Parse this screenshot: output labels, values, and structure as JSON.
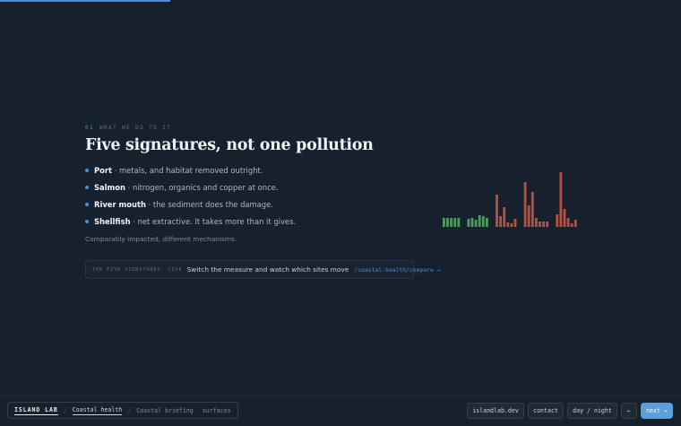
{
  "progress": {
    "fraction": 0.25
  },
  "section": {
    "number": "01",
    "eyebrow": "WHAT WE DO TO IT",
    "title": "Five signatures, not one pollution",
    "bullets": [
      {
        "term": "Port",
        "text": " · metals, and habitat removed outright."
      },
      {
        "term": "Salmon",
        "text": " · nitrogen, organics and copper at once."
      },
      {
        "term": "River mouth",
        "text": " · the sediment does the damage."
      },
      {
        "term": "Shellfish",
        "text": " · net extractive. It takes more than it gives."
      }
    ],
    "caption": "Comparably impacted, different mechanisms."
  },
  "callout": {
    "tag": "THE FIVE SIGNATURES, LIVE",
    "message": "Switch the measure and watch which sites move",
    "link": "/coastal-health/compare →"
  },
  "chart_data": {
    "type": "bar",
    "title": "",
    "xlabel": "",
    "ylabel": "",
    "ylim": [
      0,
      62
    ],
    "groups": [
      {
        "color": "#4f9a5f",
        "values": [
          10,
          10,
          10,
          10,
          10
        ]
      },
      {
        "color": "#4f9a5f",
        "values": [
          9,
          10,
          8,
          13,
          12,
          10
        ]
      },
      {
        "color": "#b8513f",
        "values": [
          36,
          12,
          22,
          5,
          4,
          9
        ]
      },
      {
        "color": "#b8513f",
        "values": [
          50,
          24,
          39,
          10,
          6,
          6,
          6
        ]
      },
      {
        "color": "#b8513f",
        "values": [
          14,
          61,
          20,
          10,
          4,
          8
        ]
      }
    ]
  },
  "footer": {
    "brand": "ISLAND LAB",
    "crumb_active": "Coastal health",
    "crumb_next": "Coastal briefing",
    "crumb_extra": "surfaces",
    "buttons": {
      "site": "islandlab.dev",
      "contact": "contact",
      "theme": "day / night",
      "prev": "←",
      "next": "next →"
    }
  }
}
